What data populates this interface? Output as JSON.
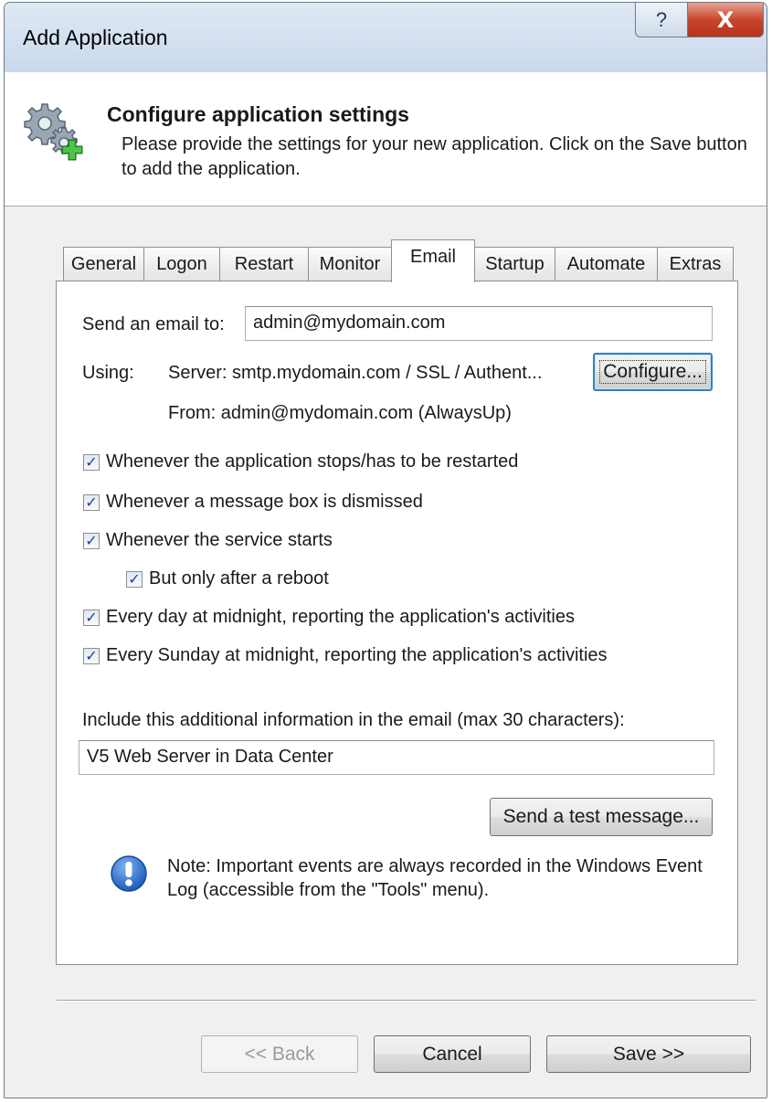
{
  "window": {
    "title": "Add Application",
    "help_glyph": "?",
    "close_glyph": "X",
    "help_icon": "help-icon",
    "close_icon": "close-icon"
  },
  "header": {
    "icon": "gear-add-icon",
    "title": "Configure application settings",
    "description": "Please provide the settings for your new application. Click on the Save button to add the application."
  },
  "tabs": [
    "General",
    "Logon",
    "Restart",
    "Monitor",
    "Email",
    "Startup",
    "Automate",
    "Extras"
  ],
  "active_tab": "Email",
  "email": {
    "send_to_label": "Send an email to:",
    "send_to_value": "admin@mydomain.com",
    "using_label": "Using:",
    "server_text": "Server: smtp.mydomain.com / SSL / Authent...",
    "from_text": "From: admin@mydomain.com (AlwaysUp)",
    "configure_button": "Configure...",
    "checkboxes": [
      {
        "label": "Whenever the application stops/has to be restarted",
        "checked": true
      },
      {
        "label": "Whenever a message box is dismissed",
        "checked": true
      },
      {
        "label": "Whenever the service starts",
        "checked": true
      },
      {
        "label": "But only after a reboot",
        "checked": true
      },
      {
        "label": "Every day at midnight, reporting the application's activities",
        "checked": true
      },
      {
        "label": "Every Sunday at midnight, reporting the application's activities",
        "checked": true
      }
    ],
    "checkmark_glyph": "✓",
    "additional_info_label": "Include this additional information in the email (max 30 characters):",
    "additional_info_value": "V5 Web Server in Data Center",
    "test_button": "Send a test message...",
    "note_icon": "info-exclamation-icon",
    "note": "Note: Important events are always recorded in the Windows Event Log (accessible from the \"Tools\" menu)."
  },
  "footer": {
    "back_button": "<< Back",
    "cancel_button": "Cancel",
    "save_button": "Save >>"
  },
  "colors": {
    "accent_blue": "#2a63b8",
    "close_red": "#c8452d",
    "focus_border": "#3c7fb1",
    "window_bg": "#f0f0f0"
  }
}
